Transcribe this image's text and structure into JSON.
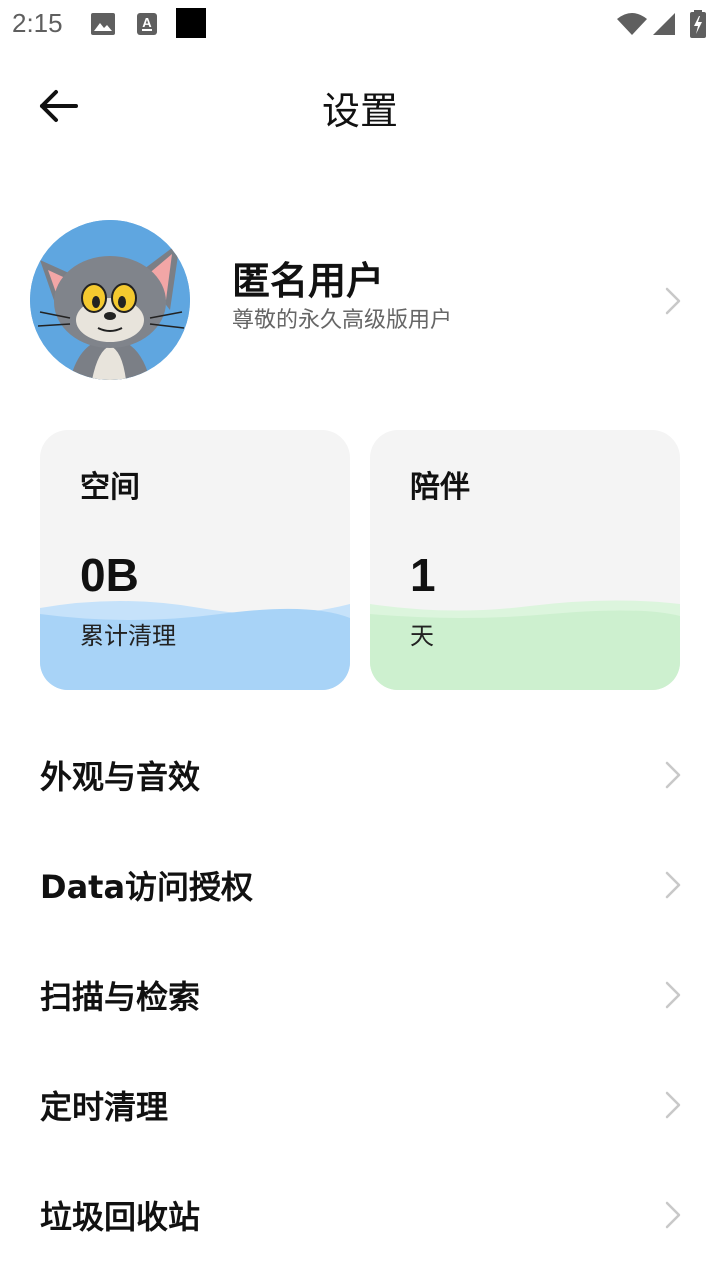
{
  "status_bar": {
    "time": "2:15",
    "icons": [
      "image-icon",
      "text-a-icon",
      "black-square-icon",
      "wifi-icon",
      "signal-icon",
      "battery-charging-icon"
    ]
  },
  "app_bar": {
    "back_icon": "arrow-left-icon",
    "title": "设置"
  },
  "profile": {
    "name": "匿名用户",
    "subtitle": "尊敬的永久高级版用户",
    "avatar": "cartoon-cat-avatar"
  },
  "cards": {
    "space": {
      "title": "空间",
      "value": "0B",
      "unit": "累计清理",
      "color": "#a8d3f7"
    },
    "companion": {
      "title": "陪伴",
      "value": "1",
      "unit": "天",
      "color": "#cdf0cf"
    }
  },
  "menu": {
    "items": [
      {
        "label": "外观与音效"
      },
      {
        "label": "Data访问授权"
      },
      {
        "label": "扫描与检索"
      },
      {
        "label": "定时清理"
      },
      {
        "label": "垃圾回收站"
      }
    ]
  },
  "colors": {
    "card_background": "#f4f4f4",
    "chevron": "#c8c8c8"
  }
}
